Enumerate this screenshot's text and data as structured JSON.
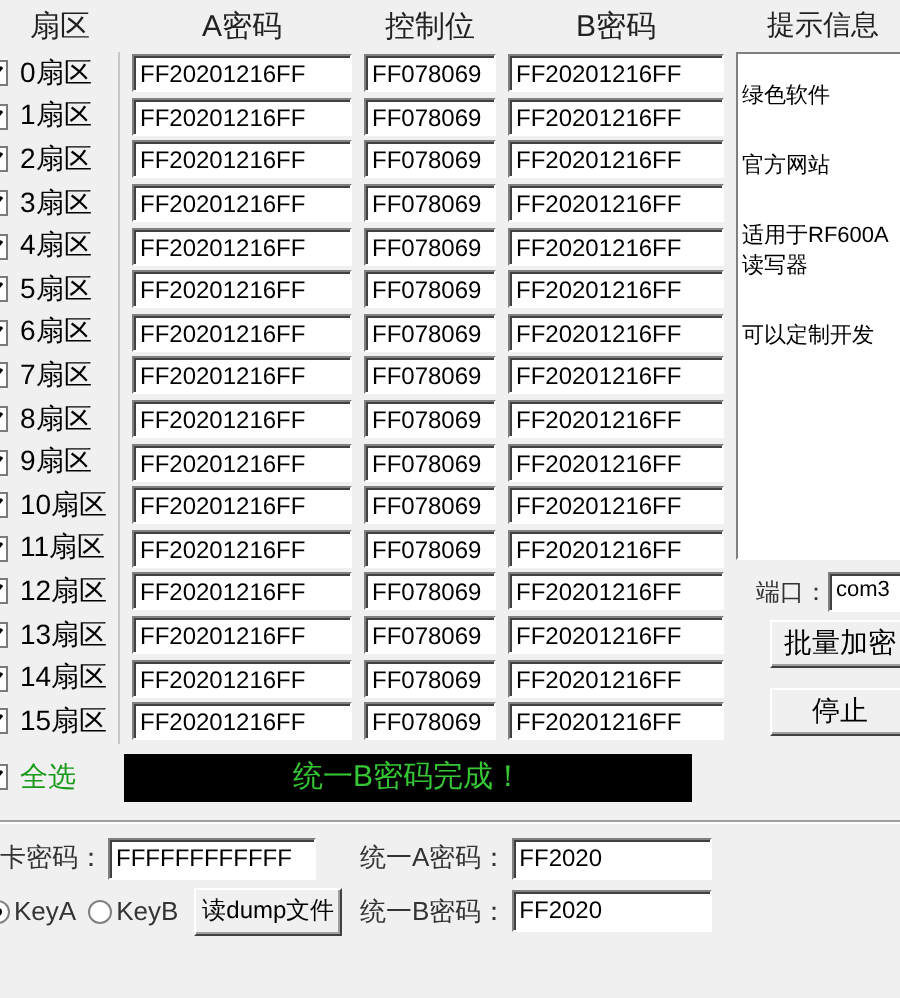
{
  "headers": {
    "sector": "扇区",
    "key_a": "A密码",
    "access": "控制位",
    "key_b": "B密码",
    "info": "提示信息"
  },
  "sectors": [
    {
      "label": "0扇区",
      "checked": true,
      "key_a": "FF20201216FF",
      "access": "FF078069",
      "key_b": "FF20201216FF"
    },
    {
      "label": "1扇区",
      "checked": true,
      "key_a": "FF20201216FF",
      "access": "FF078069",
      "key_b": "FF20201216FF"
    },
    {
      "label": "2扇区",
      "checked": true,
      "key_a": "FF20201216FF",
      "access": "FF078069",
      "key_b": "FF20201216FF"
    },
    {
      "label": "3扇区",
      "checked": true,
      "key_a": "FF20201216FF",
      "access": "FF078069",
      "key_b": "FF20201216FF"
    },
    {
      "label": "4扇区",
      "checked": true,
      "key_a": "FF20201216FF",
      "access": "FF078069",
      "key_b": "FF20201216FF"
    },
    {
      "label": "5扇区",
      "checked": true,
      "key_a": "FF20201216FF",
      "access": "FF078069",
      "key_b": "FF20201216FF"
    },
    {
      "label": "6扇区",
      "checked": true,
      "key_a": "FF20201216FF",
      "access": "FF078069",
      "key_b": "FF20201216FF"
    },
    {
      "label": "7扇区",
      "checked": true,
      "key_a": "FF20201216FF",
      "access": "FF078069",
      "key_b": "FF20201216FF"
    },
    {
      "label": "8扇区",
      "checked": true,
      "key_a": "FF20201216FF",
      "access": "FF078069",
      "key_b": "FF20201216FF"
    },
    {
      "label": "9扇区",
      "checked": true,
      "key_a": "FF20201216FF",
      "access": "FF078069",
      "key_b": "FF20201216FF"
    },
    {
      "label": "10扇区",
      "checked": true,
      "key_a": "FF20201216FF",
      "access": "FF078069",
      "key_b": "FF20201216FF"
    },
    {
      "label": "11扇区",
      "checked": true,
      "key_a": "FF20201216FF",
      "access": "FF078069",
      "key_b": "FF20201216FF"
    },
    {
      "label": "12扇区",
      "checked": true,
      "key_a": "FF20201216FF",
      "access": "FF078069",
      "key_b": "FF20201216FF"
    },
    {
      "label": "13扇区",
      "checked": true,
      "key_a": "FF20201216FF",
      "access": "FF078069",
      "key_b": "FF20201216FF"
    },
    {
      "label": "14扇区",
      "checked": true,
      "key_a": "FF20201216FF",
      "access": "FF078069",
      "key_b": "FF20201216FF"
    },
    {
      "label": "15扇区",
      "checked": true,
      "key_a": "FF20201216FF",
      "access": "FF078069",
      "key_b": "FF20201216FF"
    }
  ],
  "info": [
    {
      "lines": [
        "绿色软件"
      ]
    },
    {
      "lines": [
        "官方网站"
      ]
    },
    {
      "lines": [
        "适用于RF600A",
        "读写器"
      ]
    },
    {
      "lines": [
        "可以定制开发"
      ]
    }
  ],
  "port": {
    "label": "端口：",
    "value": "com3"
  },
  "buttons": [
    "批量加密",
    "停止"
  ],
  "select_all": {
    "label": "全选",
    "checked": true
  },
  "status": "统一B密码完成！",
  "card_key": {
    "label": "卡密码：",
    "value": "FFFFFFFFFFFF"
  },
  "key_types": [
    {
      "label": "KeyA",
      "selected": true
    },
    {
      "label": "KeyB",
      "selected": false
    }
  ],
  "dump_button": "读dump文件",
  "unify_a": {
    "label": "统一A密码：",
    "value": "FF2020"
  },
  "unify_b": {
    "label": "统一B密码：",
    "value": "FF2020"
  }
}
